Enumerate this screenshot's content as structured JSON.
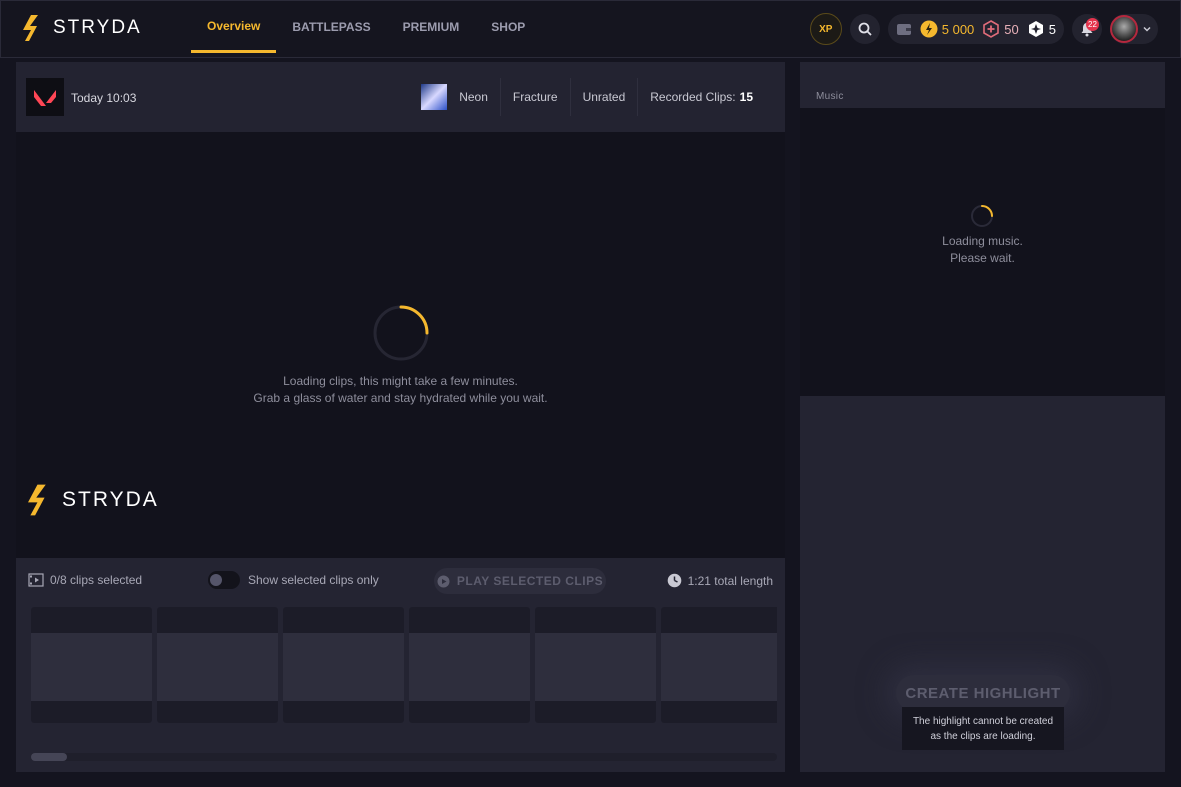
{
  "brand": {
    "name": "STRYDA"
  },
  "nav": {
    "tabs": [
      {
        "label": "Overview",
        "active": true
      },
      {
        "label": "BATTLEPASS",
        "active": false
      },
      {
        "label": "PREMIUM",
        "active": false
      },
      {
        "label": "SHOP",
        "active": false
      }
    ]
  },
  "toolbar": {
    "xp_label": "XP",
    "currencies": [
      {
        "icon": "bolt-coin-icon",
        "value": "5 000",
        "color": "#f5b82e"
      },
      {
        "icon": "plus-token-icon",
        "value": "50",
        "color": "#e06c7a"
      },
      {
        "icon": "star-token-icon",
        "value": "5",
        "color": "#ffffff"
      }
    ],
    "notifications_count": "22"
  },
  "match": {
    "time": "Today 10:03",
    "agent": "Neon",
    "map": "Fracture",
    "mode": "Unrated",
    "clips_label": "Recorded Clips:",
    "clips_count": "15"
  },
  "viewer": {
    "loading_line1": "Loading clips, this might take a few minutes.",
    "loading_line2": "Grab a glass of water and stay hydrated while you wait.",
    "watermark": "STRYDA"
  },
  "clips": {
    "selected": "0/8 clips selected",
    "toggle_label": "Show selected clips only",
    "toggle_on": false,
    "play_label": "PLAY SELECTED CLIPS",
    "total_length": "1:21 total length",
    "tile_count": 6
  },
  "music": {
    "label": "Music",
    "loading_line1": "Loading music.",
    "loading_line2": "Please wait."
  },
  "highlight": {
    "button_label": "CREATE HIGHLIGHT",
    "tooltip_line1": "The highlight cannot be created",
    "tooltip_line2": "as the clips are loading."
  },
  "colors": {
    "accent": "#f5b82e",
    "badge": "#e4344d",
    "valorant": "#ff4655"
  }
}
